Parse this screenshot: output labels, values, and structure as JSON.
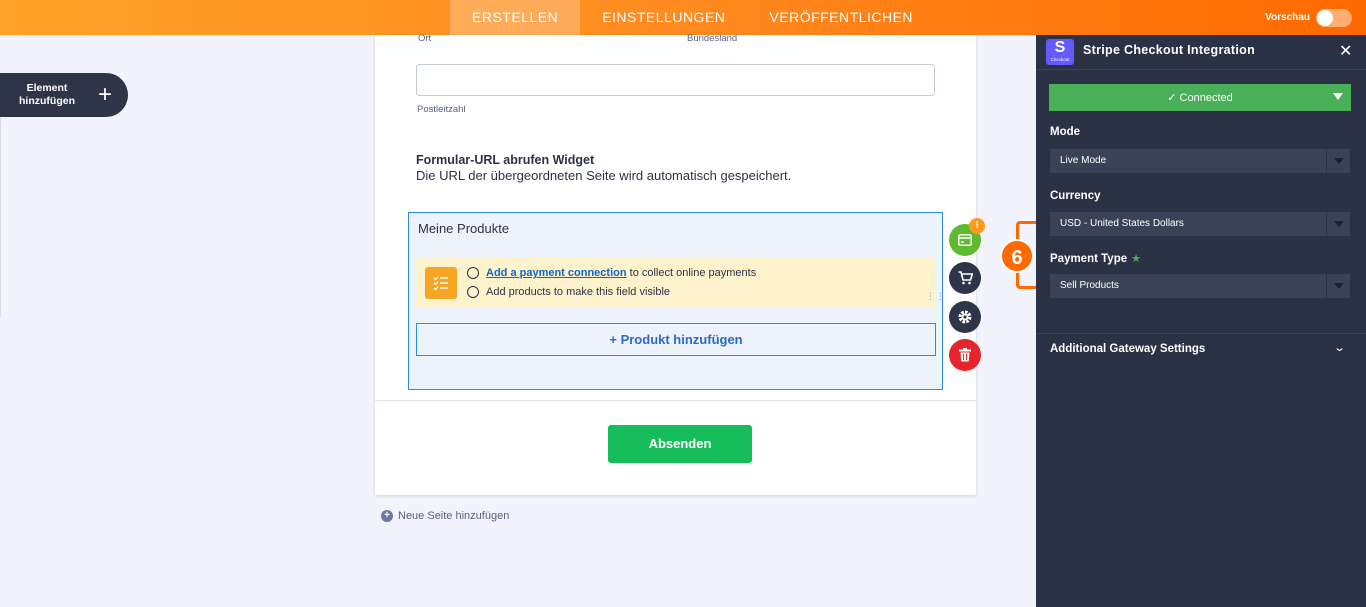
{
  "topbar": {
    "tabs": [
      {
        "label": "ERSTELLEN",
        "active": true
      },
      {
        "label": "EINSTELLUNGEN",
        "active": false
      },
      {
        "label": "VERÖFFENTLICHEN",
        "active": false
      }
    ],
    "preview_label": "Vorschau"
  },
  "left": {
    "add_element_label": "Element hinzufügen",
    "plus": "+"
  },
  "form": {
    "label_ort": "Ort",
    "label_bundesland": "Bundesland",
    "label_postleitzahl": "Postleitzahl",
    "widget_title": "Formular-URL abrufen Widget",
    "widget_desc": "Die URL der übergeordneten Seite wird automatisch gespeichert.",
    "products_title": "Meine Produkte",
    "notice_link": "Add a payment connection",
    "notice_line1_rest": "to collect online payments",
    "notice_line2": "Add products to make this field visible",
    "add_product_label": "+ Produkt hinzufügen",
    "submit_label": "Absenden",
    "new_page_label": "Neue Seite hinzufügen",
    "badge": "!"
  },
  "panel": {
    "title": "Stripe Checkout Integration",
    "logo_letter": "S",
    "logo_caption": "Checkout",
    "close": "✕",
    "connected_label": "✓ Connected",
    "mode_label": "Mode",
    "mode_value": "Live Mode",
    "currency_label": "Currency",
    "currency_value": "USD - United States Dollars",
    "payment_type_label": "Payment Type",
    "payment_type_value": "Sell Products",
    "additional_label": "Additional Gateway Settings"
  },
  "annotation": {
    "step_number": "6"
  },
  "colors": {
    "accent_orange": "#ff6a00",
    "panel_bg": "#2b3245",
    "connected_green": "#49b059",
    "submit_green": "#18bd5b",
    "delete_red": "#e5242b"
  }
}
